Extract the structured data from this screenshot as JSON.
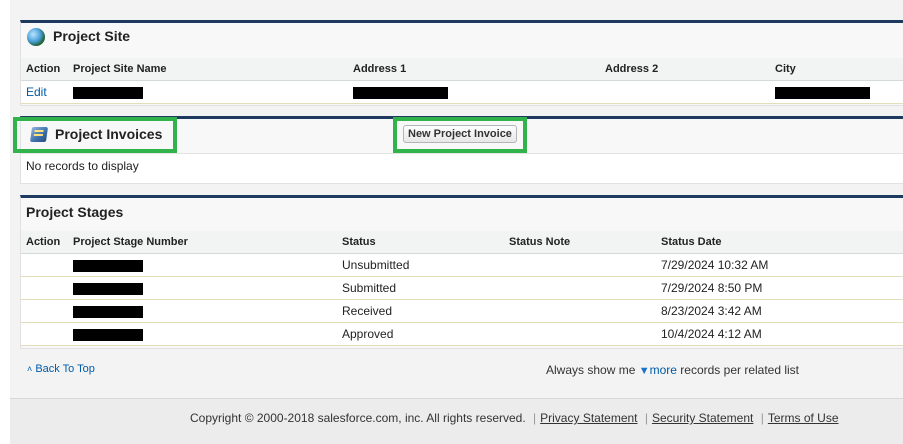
{
  "project_site": {
    "title": "Project Site",
    "headers": [
      "Action",
      "Project Site Name",
      "Address 1",
      "Address 2",
      "City"
    ],
    "rows": [
      {
        "action": "Edit"
      }
    ]
  },
  "project_invoices": {
    "title": "Project Invoices",
    "new_button": "New Project Invoice",
    "empty_message": "No records to display"
  },
  "project_stages": {
    "title": "Project Stages",
    "headers": [
      "Action",
      "Project Stage Number",
      "Status",
      "Status Note",
      "Status Date"
    ],
    "rows": [
      {
        "status": "Unsubmitted",
        "date": "7/29/2024 10:32 AM"
      },
      {
        "status": "Submitted",
        "date": "7/29/2024 8:50 PM"
      },
      {
        "status": "Received",
        "date": "8/23/2024 3:42 AM"
      },
      {
        "status": "Approved",
        "date": "10/4/2024 4:12 AM"
      }
    ]
  },
  "nav": {
    "back_to_top": "Back To Top",
    "show_prefix": "Always show me",
    "more_link": "more",
    "show_suffix": "records per related list"
  },
  "footer": {
    "copyright": "Copyright © 2000-2018 salesforce.com, inc. All rights reserved.",
    "privacy": "Privacy Statement",
    "security": "Security Statement",
    "terms": "Terms of Use"
  },
  "colors": {
    "highlight_border": "#2fb34a",
    "panel_border": "#1f3a5f",
    "link": "#015ba7"
  },
  "icons": [
    "globe-icon",
    "invoice-icon",
    "chevron-up-icon",
    "triangle-down-icon"
  ]
}
